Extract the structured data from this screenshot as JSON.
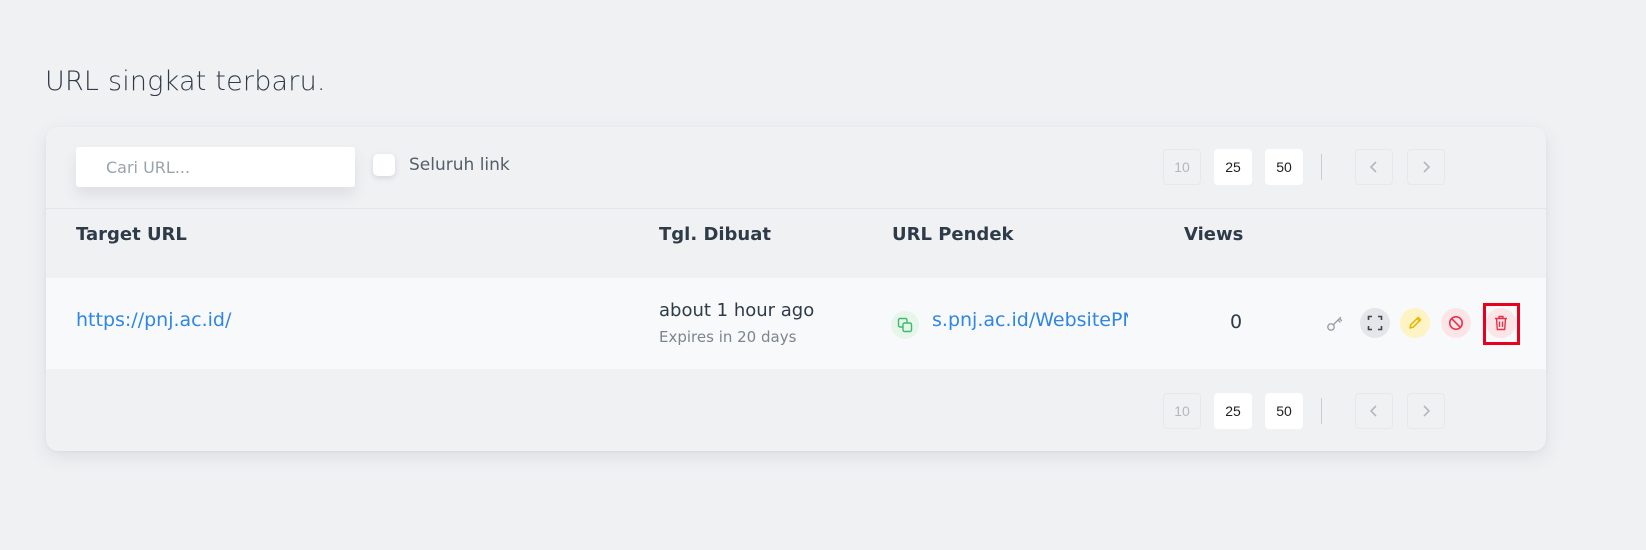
{
  "page": {
    "title": "URL singkat terbaru."
  },
  "toolbar": {
    "search_placeholder": "Cari URL...",
    "all_links_label": "Seluruh link",
    "page_sizes": [
      "10",
      "25",
      "50"
    ]
  },
  "table": {
    "headers": [
      "Target URL",
      "Tgl. Dibuat",
      "URL Pendek",
      "Views"
    ],
    "rows": [
      {
        "target": "https://pnj.ac.id/",
        "created": "about 1 hour ago",
        "expires": "Expires in 20 days",
        "short": "s.pnj.ac.id/WebsitePNJ",
        "views": "0"
      }
    ]
  },
  "actions": [
    "key-icon",
    "qrcode-icon",
    "edit-icon",
    "ban-icon",
    "trash-icon"
  ],
  "colors": {
    "link": "#2f86e6",
    "copy_green": "#3dbb6a",
    "edit_yellow": "#e5b800",
    "danger_red": "#e8324a",
    "highlight": "#e8001c"
  }
}
